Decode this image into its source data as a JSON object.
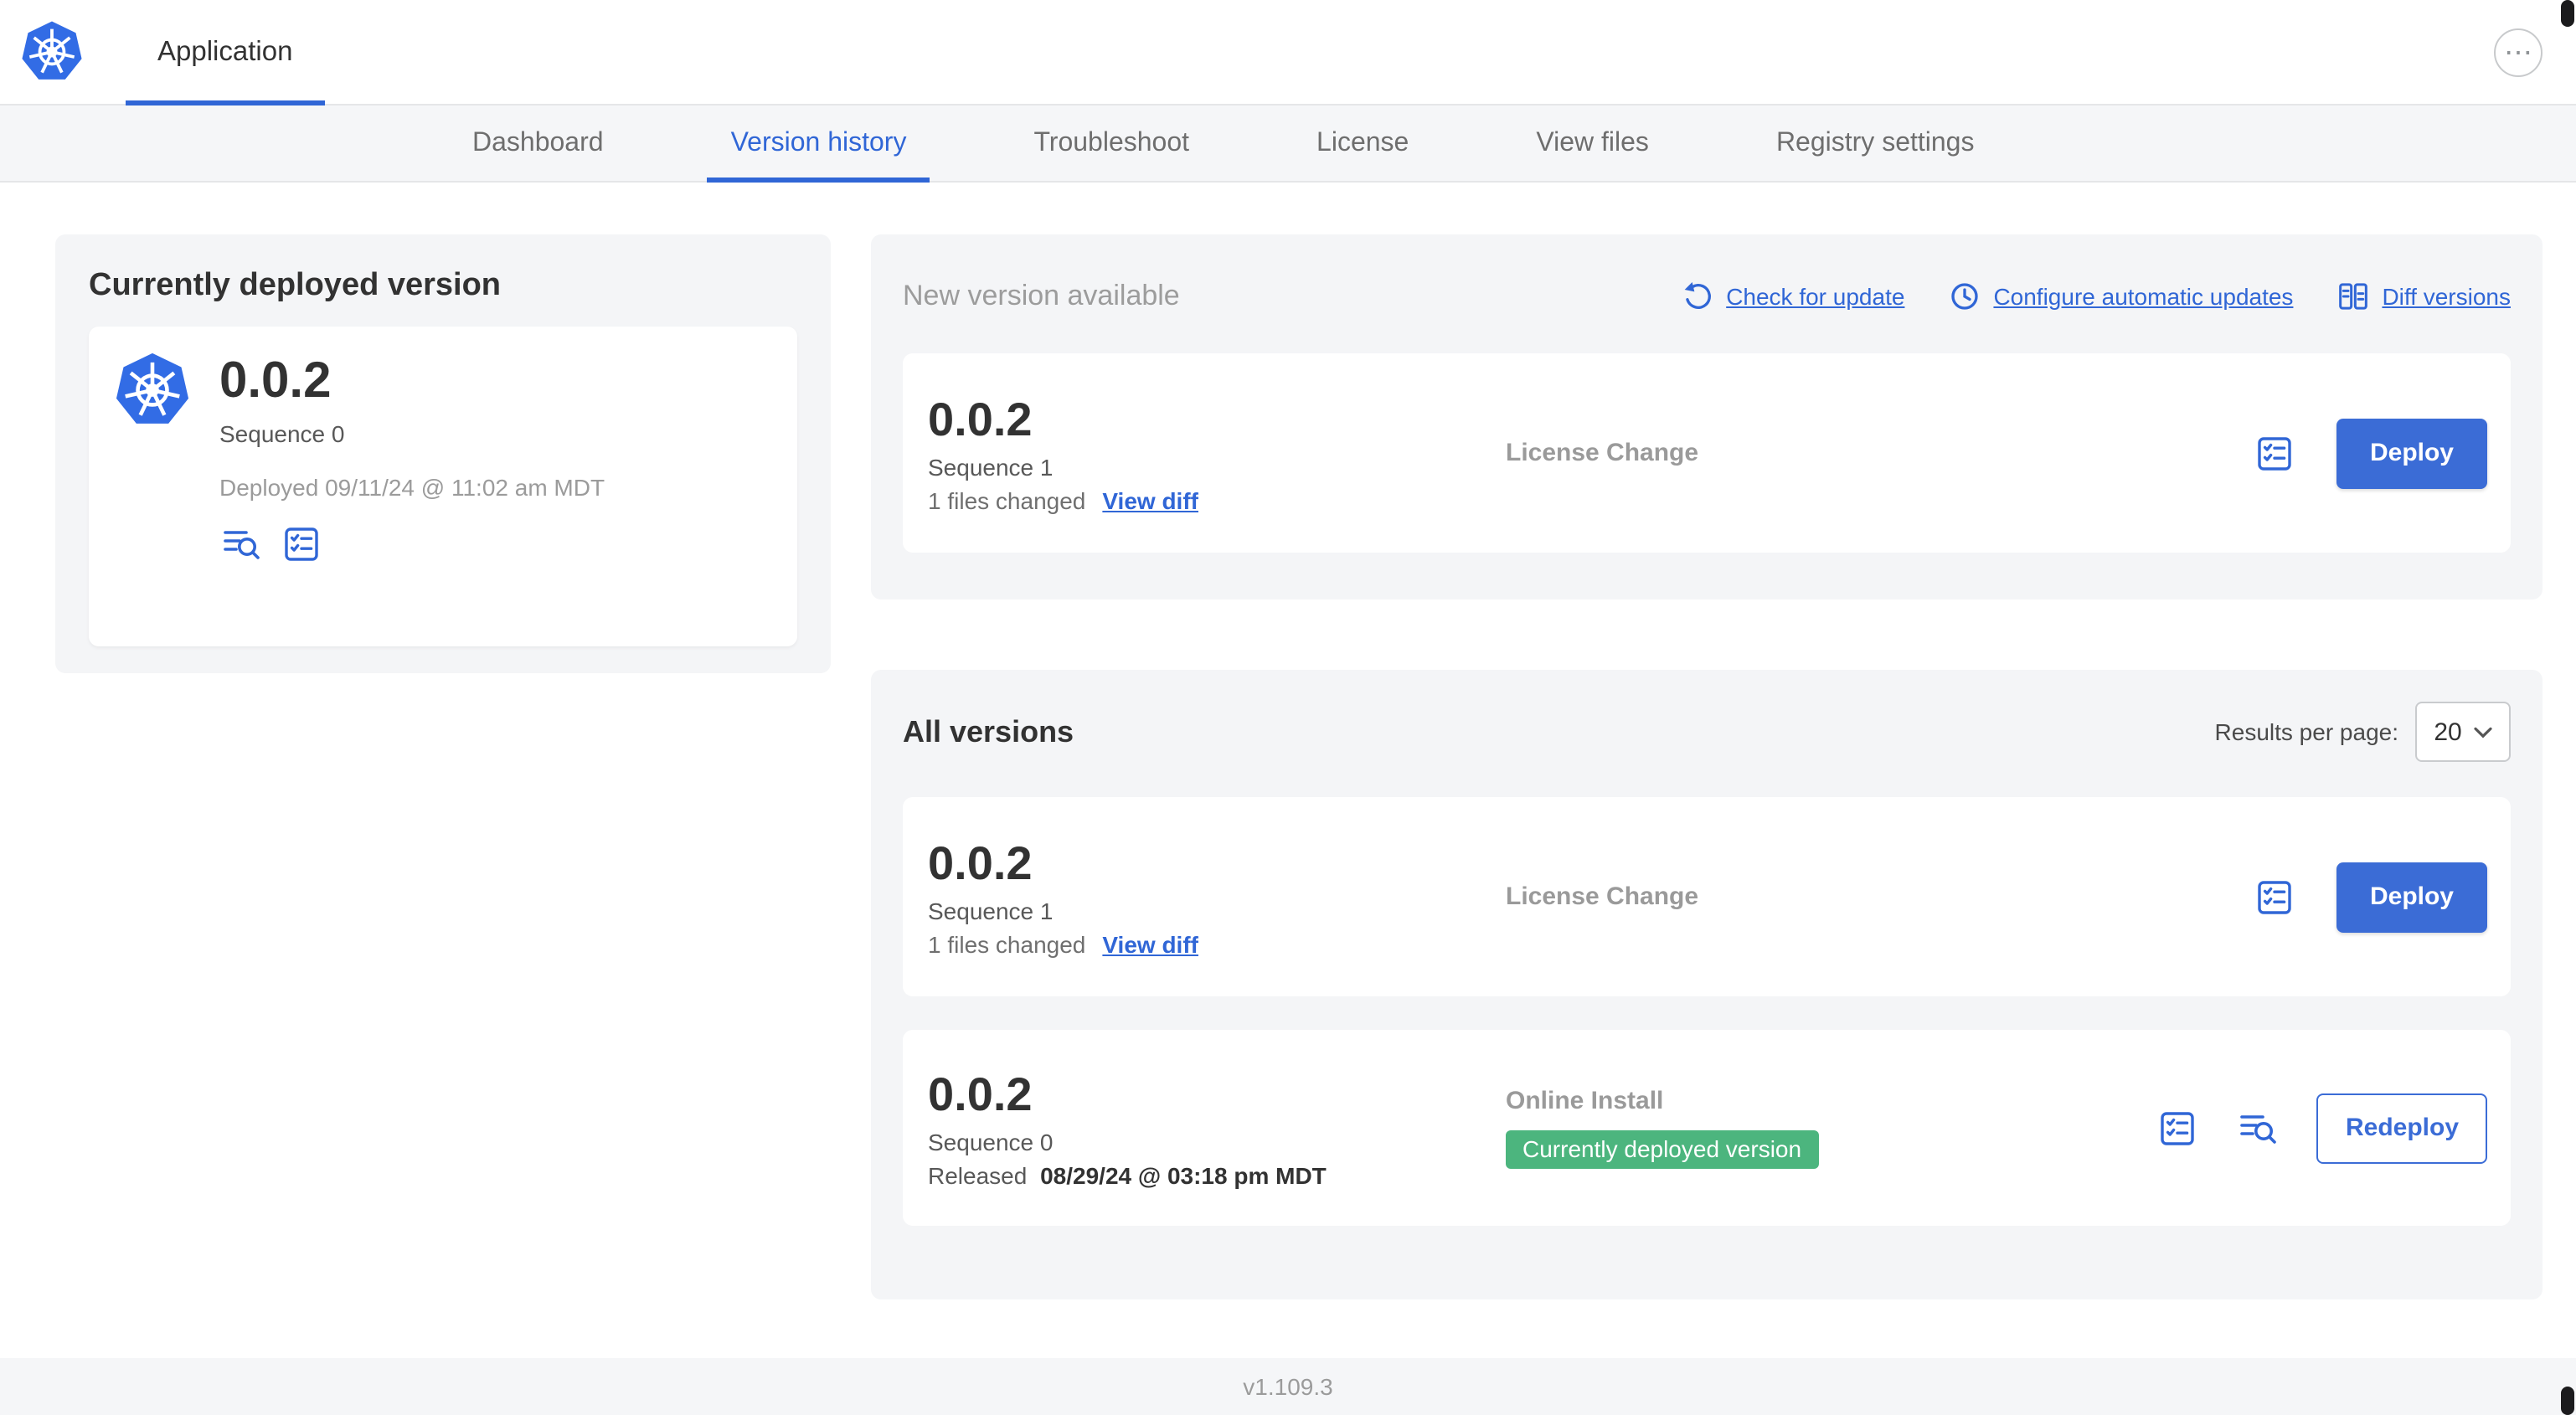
{
  "colors": {
    "accent_blue": "#3b6cd6",
    "link_blue": "#3066d6",
    "k8s_blue": "#326ce5",
    "badge_green": "#4cb57e"
  },
  "header": {
    "app_tab": "Application",
    "more_glyph": "⋯"
  },
  "nav": {
    "tabs": [
      {
        "label": "Dashboard"
      },
      {
        "label": "Version history"
      },
      {
        "label": "Troubleshoot"
      },
      {
        "label": "License"
      },
      {
        "label": "View files"
      },
      {
        "label": "Registry settings"
      }
    ]
  },
  "current_version": {
    "title": "Currently deployed version",
    "version": "0.0.2",
    "sequence": "Sequence 0",
    "deployed": "Deployed 09/11/24 @ 11:02 am MDT"
  },
  "new_version": {
    "title": "New version available",
    "check_for_update": "Check for update",
    "configure_updates": "Configure automatic updates",
    "diff_versions": "Diff versions",
    "row": {
      "version": "0.0.2",
      "sequence": "Sequence 1",
      "files_changed": "1 files changed",
      "view_diff": "View diff",
      "source": "License Change",
      "action": "Deploy"
    }
  },
  "all_versions": {
    "title": "All versions",
    "results_per_page_label": "Results per page:",
    "results_per_page_value": "20",
    "rows": [
      {
        "version": "0.0.2",
        "sequence": "Sequence 1",
        "files_changed": "1 files changed",
        "view_diff": "View diff",
        "source": "License Change",
        "action": "Deploy"
      },
      {
        "version": "0.0.2",
        "sequence": "Sequence 0",
        "released_label": "Released",
        "released_date": "08/29/24 @ 03:18 pm MDT",
        "source": "Online Install",
        "badge": "Currently deployed version",
        "action": "Redeploy"
      }
    ]
  },
  "footer": {
    "version": "v1.109.3"
  }
}
